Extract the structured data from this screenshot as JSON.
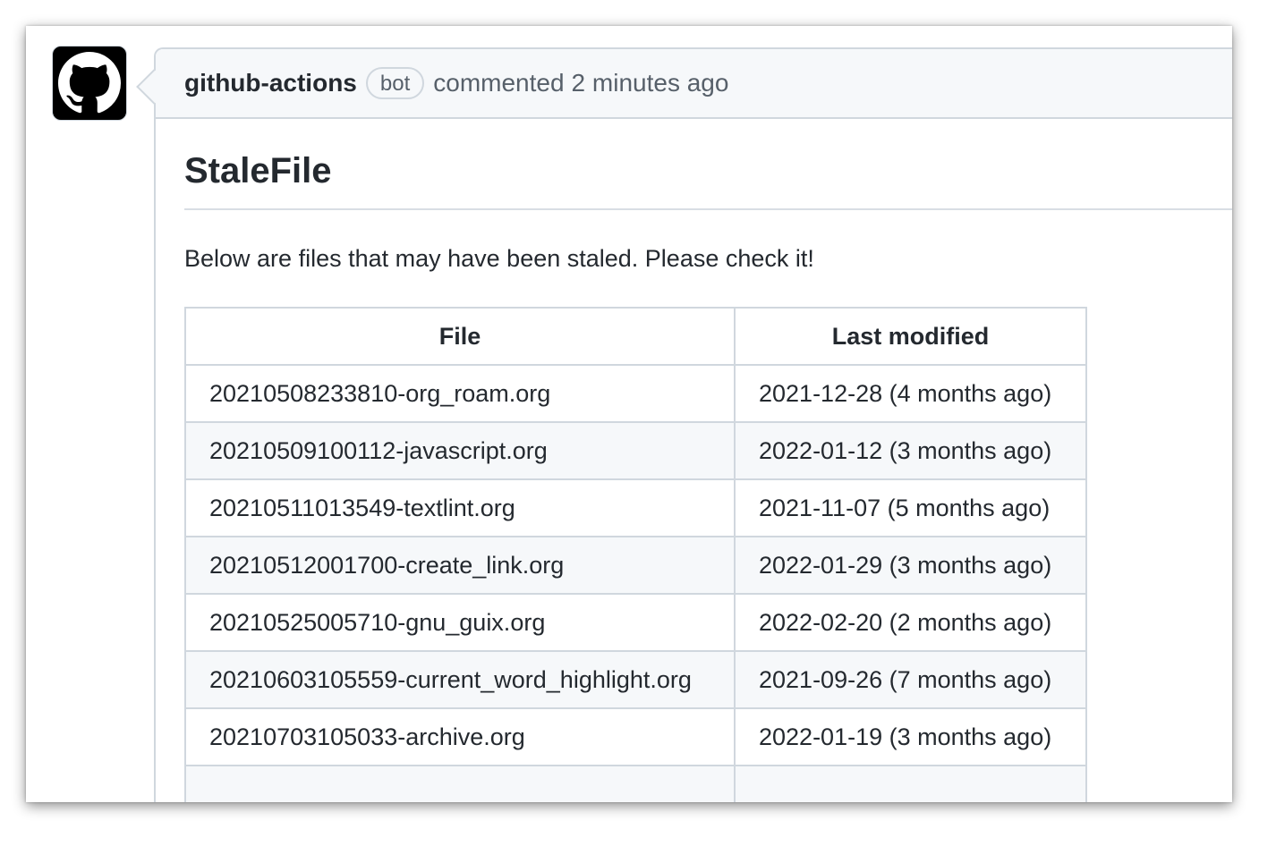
{
  "comment": {
    "author": "github-actions",
    "badge": "bot",
    "action": "commented",
    "timestamp": "2 minutes ago"
  },
  "body": {
    "title": "StaleFile",
    "description": "Below are files that may have been staled. Please check it!",
    "table": {
      "headers": [
        "File",
        "Last modified"
      ],
      "rows": [
        {
          "file": "20210508233810-org_roam.org",
          "modified": "2021-12-28 (4 months ago)"
        },
        {
          "file": "20210509100112-javascript.org",
          "modified": "2022-01-12 (3 months ago)"
        },
        {
          "file": "20210511013549-textlint.org",
          "modified": "2021-11-07 (5 months ago)"
        },
        {
          "file": "20210512001700-create_link.org",
          "modified": "2022-01-29 (3 months ago)"
        },
        {
          "file": "20210525005710-gnu_guix.org",
          "modified": "2022-02-20 (2 months ago)"
        },
        {
          "file": "20210603105559-current_word_highlight.org",
          "modified": "2021-09-26 (7 months ago)"
        },
        {
          "file": "20210703105033-archive.org",
          "modified": "2022-01-19 (3 months ago)"
        },
        {
          "file": "",
          "modified": ""
        }
      ]
    }
  },
  "colors": {
    "border": "#d0d7de",
    "header_bg": "#f6f8fa",
    "text": "#24292f",
    "muted": "#57606a"
  },
  "icons": {
    "avatar": "github-octocat-icon"
  }
}
